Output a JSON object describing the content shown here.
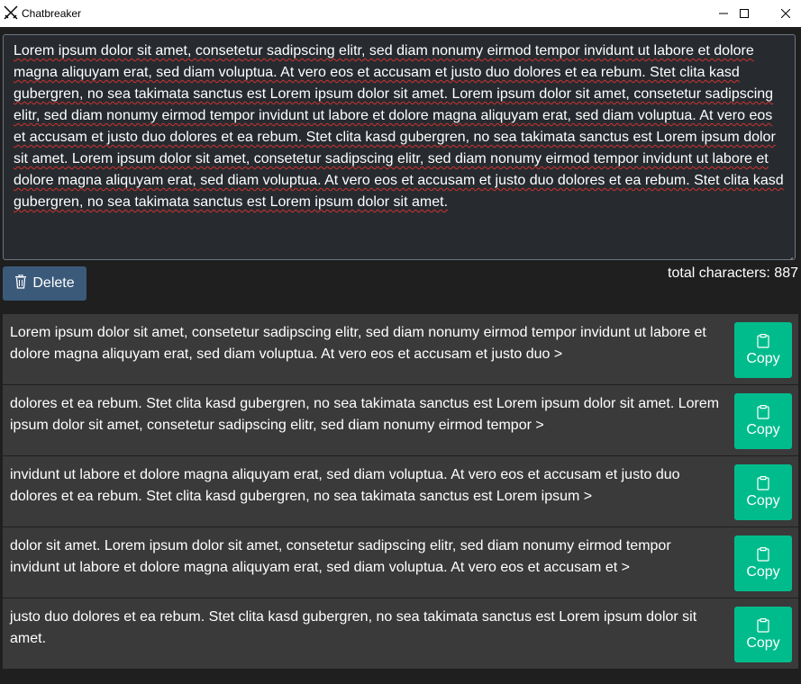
{
  "window": {
    "title": "Chatbreaker"
  },
  "editor": {
    "text": "Lorem ipsum dolor sit amet, consetetur sadipscing elitr, sed diam nonumy eirmod tempor invidunt ut labore et dolore magna aliquyam erat, sed diam voluptua. At vero eos et accusam et justo duo dolores et ea rebum. Stet clita kasd gubergren, no sea takimata sanctus est Lorem ipsum dolor sit amet. Lorem ipsum dolor sit amet, consetetur sadipscing elitr, sed diam nonumy eirmod tempor invidunt ut labore et dolore magna aliquyam erat, sed diam voluptua. At vero eos et accusam et justo duo dolores et ea rebum. Stet clita kasd gubergren, no sea takimata sanctus est Lorem ipsum dolor sit amet. Lorem ipsum dolor sit amet, consetetur sadipscing elitr, sed diam nonumy eirmod tempor invidunt ut labore et dolore magna aliquyam erat, sed diam voluptua. At vero eos et accusam et justo duo dolores et ea rebum. Stet clita kasd gubergren, no sea takimata sanctus est Lorem ipsum dolor sit amet."
  },
  "toolbar": {
    "delete_label": "Delete",
    "char_count_label": "total characters: 887"
  },
  "chunks": [
    {
      "text": "Lorem ipsum dolor sit amet, consetetur sadipscing elitr, sed diam nonumy eirmod tempor invidunt ut labore et dolore magna aliquyam erat, sed diam voluptua. At vero eos et accusam et justo duo >",
      "copy_label": "Copy"
    },
    {
      "text": "dolores et ea rebum. Stet clita kasd gubergren, no sea takimata sanctus est Lorem ipsum dolor sit amet. Lorem ipsum dolor sit amet, consetetur sadipscing elitr, sed diam nonumy eirmod tempor >",
      "copy_label": "Copy"
    },
    {
      "text": "invidunt ut labore et dolore magna aliquyam erat, sed diam voluptua. At vero eos et accusam et justo duo dolores et ea rebum. Stet clita kasd gubergren, no sea takimata sanctus est Lorem ipsum >",
      "copy_label": "Copy"
    },
    {
      "text": "dolor sit amet. Lorem ipsum dolor sit amet, consetetur sadipscing elitr, sed diam nonumy eirmod tempor invidunt ut labore et dolore magna aliquyam erat, sed diam voluptua. At vero eos et accusam et >",
      "copy_label": "Copy"
    },
    {
      "text": "justo duo dolores et ea rebum. Stet clita kasd gubergren, no sea takimata sanctus est Lorem ipsum dolor sit amet.",
      "copy_label": "Copy"
    }
  ],
  "colors": {
    "background": "#1f1f1f",
    "editor_bg": "#272b30",
    "chunk_bg": "#3a3a3a",
    "delete_button": "#3b5a7a",
    "copy_button": "#00bc8c",
    "spellcheck": "#d0312d"
  },
  "icons": {
    "app": "crossed-swords-icon",
    "delete": "trash-icon",
    "copy": "clipboard-icon"
  }
}
